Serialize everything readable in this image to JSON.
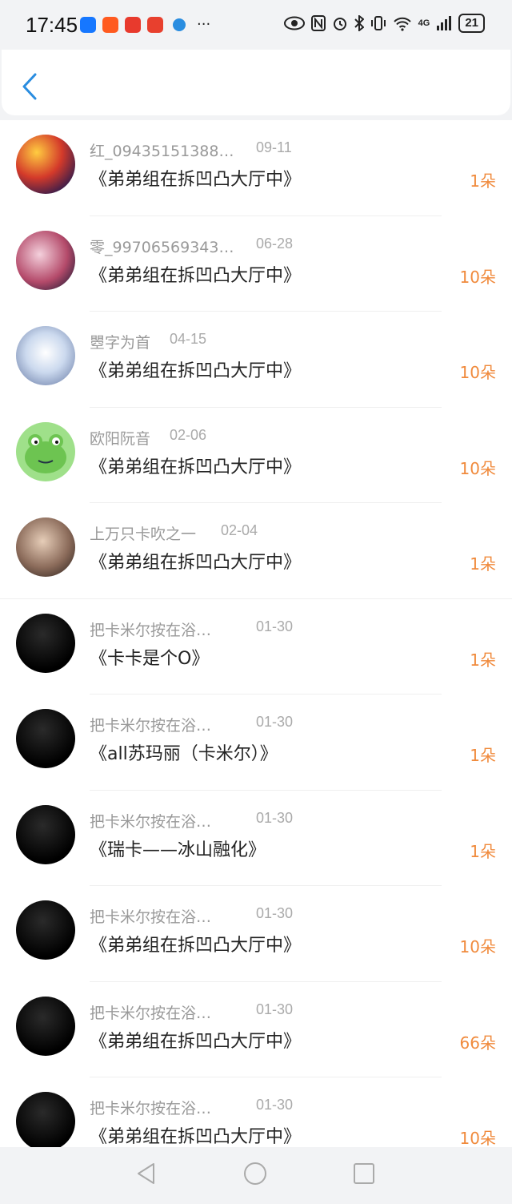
{
  "status_bar": {
    "time": "17:45",
    "more": "···",
    "battery": "21",
    "signal_label": "4G"
  },
  "colors": {
    "accent": "#f08a3c",
    "back_icon": "#2a8de0"
  },
  "header": {
    "back_icon": "chevron-left-icon"
  },
  "items": [
    {
      "name": "红_09435151388…",
      "date": "09-11",
      "title": "《弟弟组在拆凹凸大厅中》",
      "count": "1朵",
      "avatar": "anime-avatar"
    },
    {
      "name": "零_99706569343…",
      "date": "06-28",
      "title": "《弟弟组在拆凹凸大厅中》",
      "count": "10朵",
      "avatar": "anime-avatar"
    },
    {
      "name": "瞾字为首",
      "date": "04-15",
      "title": "《弟弟组在拆凹凸大厅中》",
      "count": "10朵",
      "avatar": "anime-avatar"
    },
    {
      "name": "欧阳阮音",
      "date": "02-06",
      "title": "《弟弟组在拆凹凸大厅中》",
      "count": "10朵",
      "avatar": "frog-avatar"
    },
    {
      "name": "上万只卡吹之一",
      "date": "02-04",
      "title": "《弟弟组在拆凹凸大厅中》",
      "count": "1朵",
      "avatar": "photo-avatar"
    },
    {
      "name": "把卡米尔按在浴…",
      "date": "01-30",
      "title": "《卡卡是个O》",
      "count": "1朵",
      "avatar": "black-avatar"
    },
    {
      "name": "把卡米尔按在浴…",
      "date": "01-30",
      "title": "《all苏玛丽（卡米尔）》",
      "count": "1朵",
      "avatar": "black-avatar"
    },
    {
      "name": "把卡米尔按在浴…",
      "date": "01-30",
      "title": "《瑞卡——冰山融化》",
      "count": "1朵",
      "avatar": "black-avatar"
    },
    {
      "name": "把卡米尔按在浴…",
      "date": "01-30",
      "title": "《弟弟组在拆凹凸大厅中》",
      "count": "10朵",
      "avatar": "black-avatar"
    },
    {
      "name": "把卡米尔按在浴…",
      "date": "01-30",
      "title": "《弟弟组在拆凹凸大厅中》",
      "count": "66朵",
      "avatar": "black-avatar"
    },
    {
      "name": "把卡米尔按在浴…",
      "date": "01-30",
      "title": "《弟弟组在拆凹凸大厅中》",
      "count": "10朵",
      "avatar": "black-avatar"
    }
  ],
  "nav": {
    "back": "triangle-back-icon",
    "home": "circle-home-icon",
    "recents": "square-recents-icon"
  }
}
